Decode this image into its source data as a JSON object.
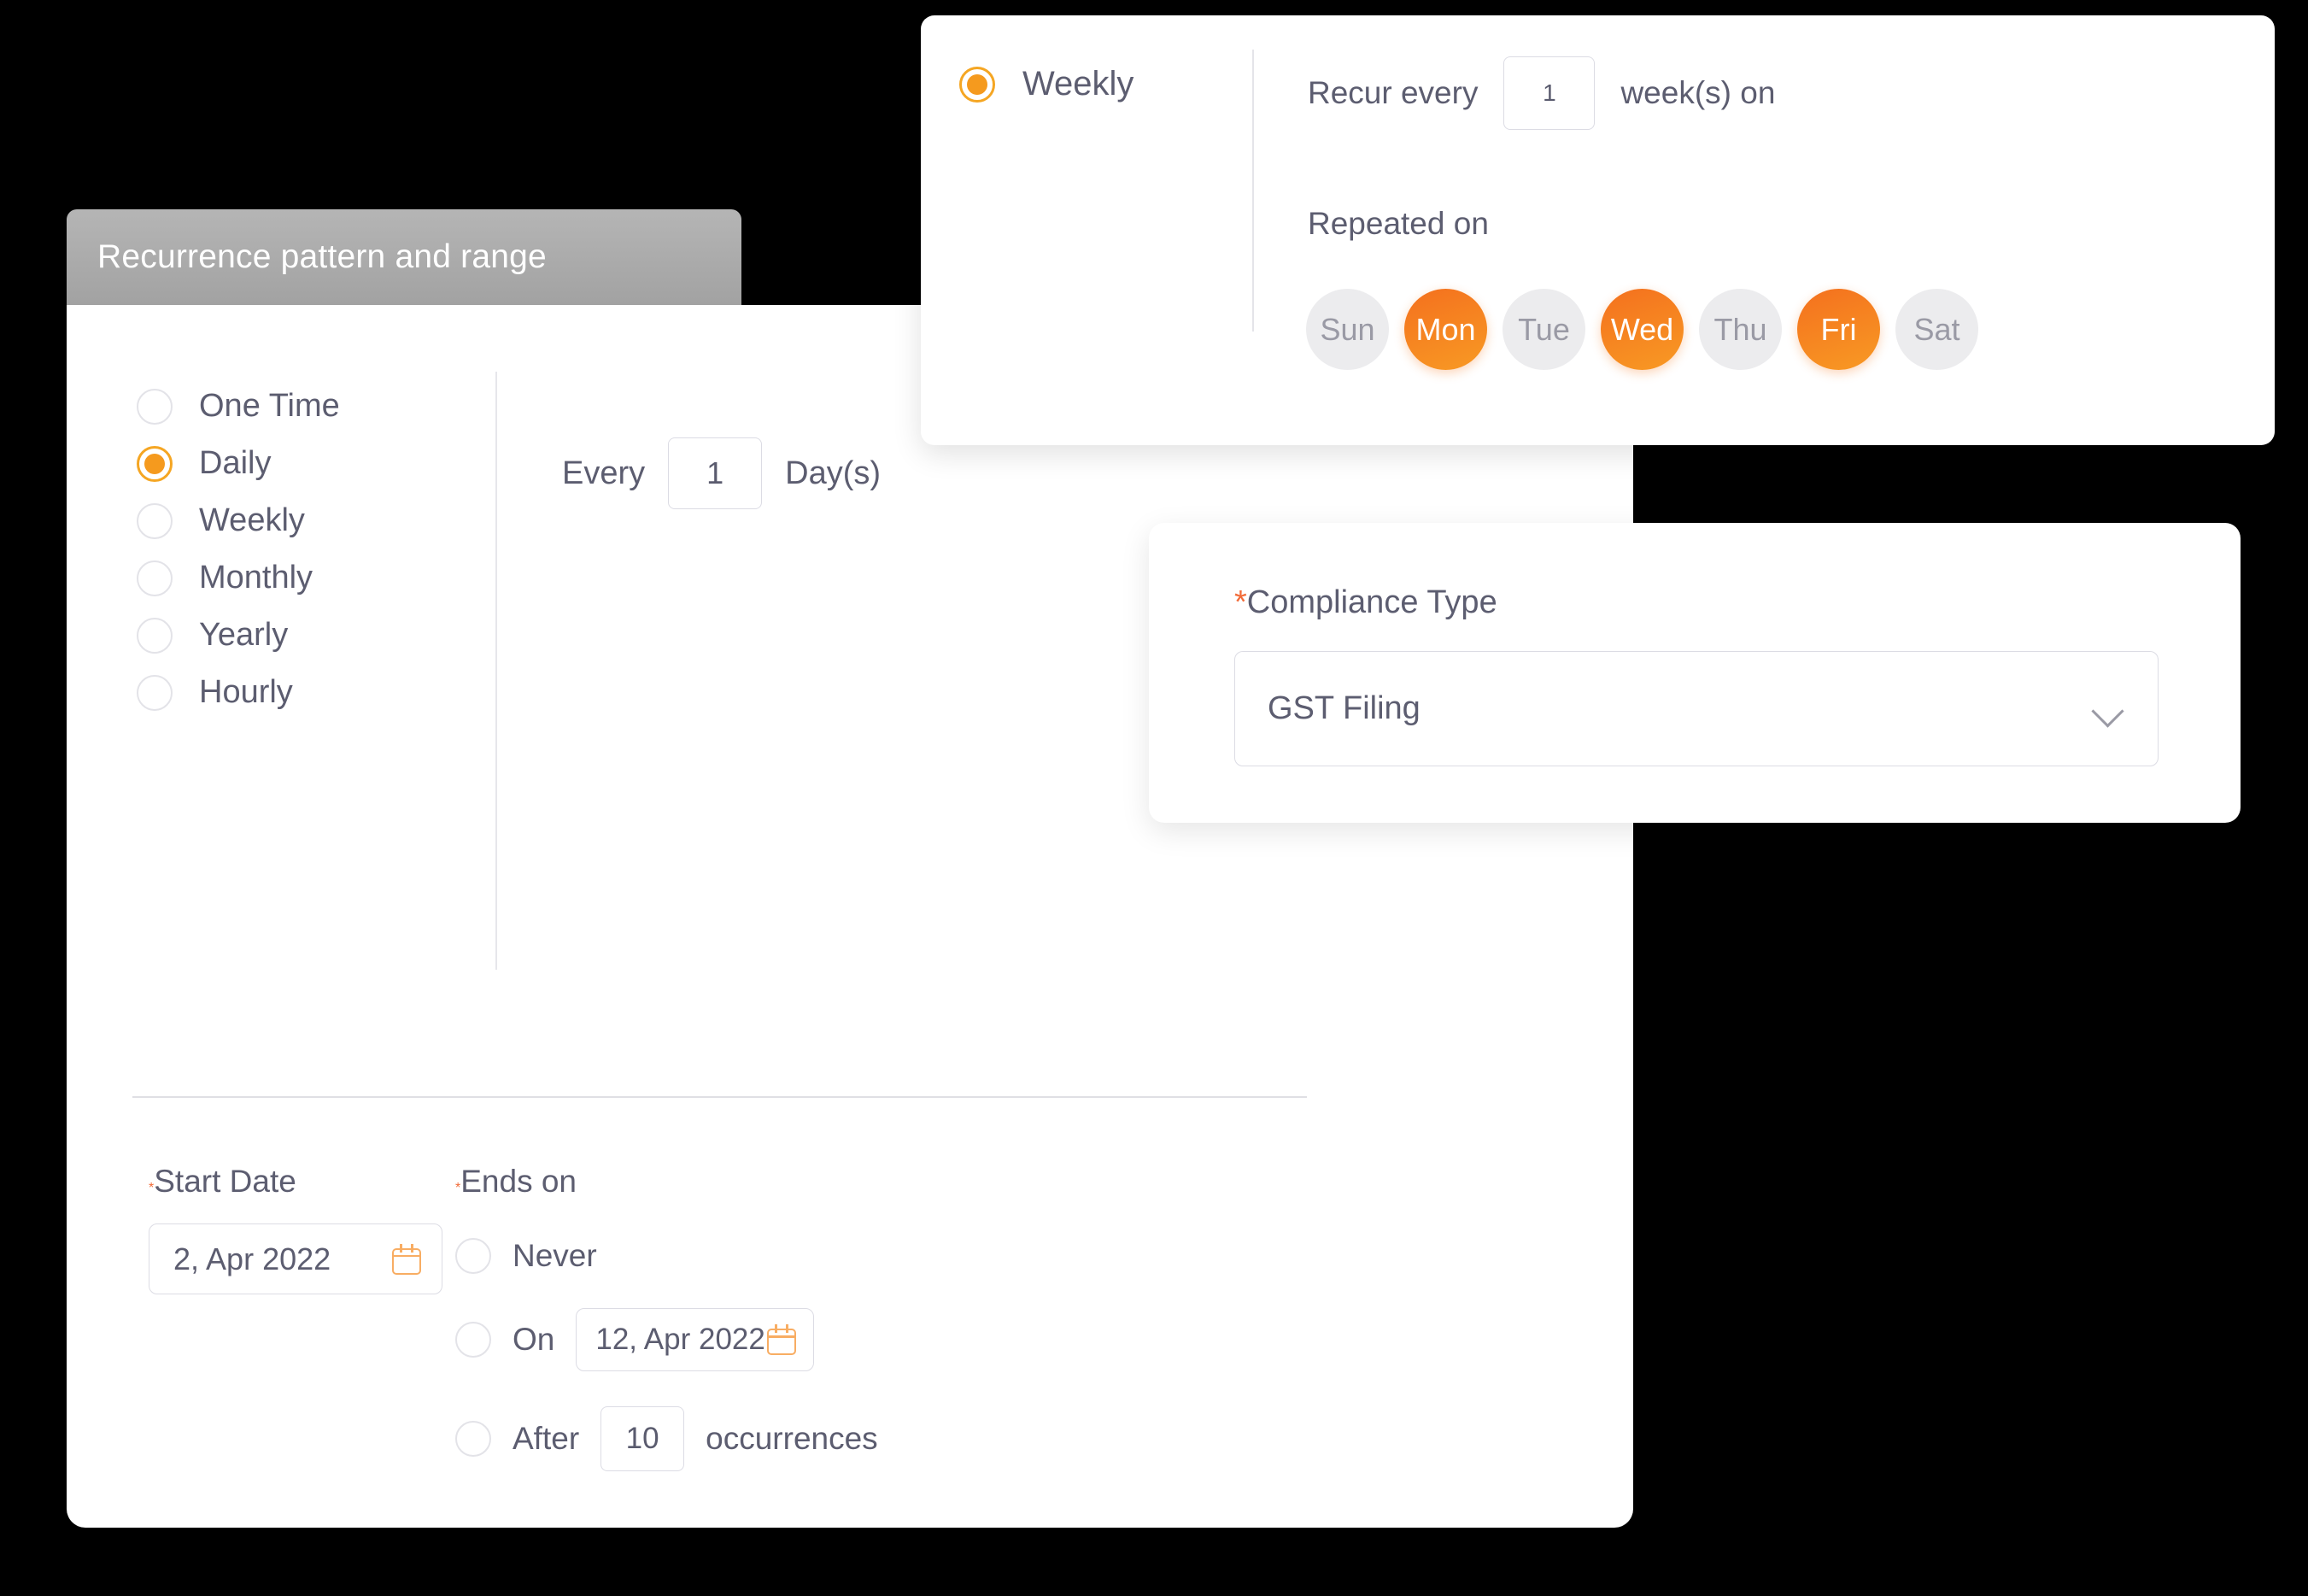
{
  "recurrence_panel": {
    "title": "Recurrence pattern and range",
    "frequency_options": [
      {
        "label": "One Time",
        "selected": false
      },
      {
        "label": "Daily",
        "selected": true
      },
      {
        "label": "Weekly",
        "selected": false
      },
      {
        "label": "Monthly",
        "selected": false
      },
      {
        "label": "Yearly",
        "selected": false
      },
      {
        "label": "Hourly",
        "selected": false
      }
    ],
    "every": {
      "prefix_label": "Every",
      "value": "1",
      "suffix_label": "Day(s)"
    },
    "start_date": {
      "required_mark": "*",
      "label": "Start Date",
      "value": "2, Apr 2022",
      "icon": "calendar-icon"
    },
    "ends_on": {
      "required_mark": "*",
      "label": "Ends on",
      "never": {
        "label": "Never",
        "selected": false
      },
      "on": {
        "label": "On",
        "selected": false,
        "value": "12, Apr 2022",
        "icon": "calendar-icon"
      },
      "after": {
        "label": "After",
        "selected": false,
        "value": "10",
        "suffix_label": "occurrences"
      }
    }
  },
  "weekly_card": {
    "radio": {
      "label": "Weekly",
      "selected": true
    },
    "recur_every": {
      "prefix_label": "Recur every",
      "value": "1",
      "suffix_label": "week(s) on"
    },
    "repeated_on_label": "Repeated on",
    "days": [
      {
        "label": "Sun",
        "selected": false
      },
      {
        "label": "Mon",
        "selected": true
      },
      {
        "label": "Tue",
        "selected": false
      },
      {
        "label": "Wed",
        "selected": true
      },
      {
        "label": "Thu",
        "selected": false
      },
      {
        "label": "Fri",
        "selected": true
      },
      {
        "label": "Sat",
        "selected": false
      }
    ]
  },
  "compliance_card": {
    "required_mark": "*",
    "label": "Compliance Type",
    "selected_value": "GST Filing",
    "chevron_icon": "chevron-down-icon"
  },
  "colors": {
    "accent_orange": "#F59A1E",
    "accent_gradient_start": "#F4701E",
    "accent_gradient_end": "#F89A24",
    "required_star": "#F26B38",
    "text": "#5C5D70",
    "muted_text": "#9A9AA5",
    "header_gray": "#A9A9A9",
    "background": "#000000"
  }
}
